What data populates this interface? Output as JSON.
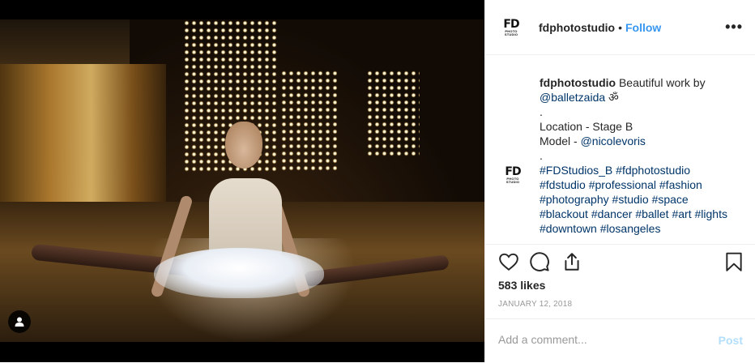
{
  "post": {
    "username": "fdphotostudio",
    "separator": "•",
    "follow_label": "Follow",
    "more_label": "•••",
    "logo_text": "FD",
    "logo_sub": "PHOTO STUDIO"
  },
  "caption": {
    "username": "fdphotostudio",
    "line1_text": " Beautiful work by",
    "mention_artist": "@balletzaida",
    "artist_emoji": "ॐ",
    "dot1": ".",
    "location": "Location - Stage B",
    "model_label": "Model - ",
    "mention_model": "@nicolevoris",
    "dot2": ".",
    "hashtags": [
      "#FDStudios_B",
      "#fdphotostudio",
      "#fdstudio",
      "#professional",
      "#fashion",
      "#photography",
      "#studio",
      "#space",
      "#blackout",
      "#dancer",
      "#ballet",
      "#art",
      "#lights",
      "#downtown",
      "#losangeles"
    ]
  },
  "stats": {
    "likes": "583 likes",
    "date": "JANUARY 12, 2018"
  },
  "comment": {
    "placeholder": "Add a comment...",
    "post_label": "Post"
  },
  "icons": [
    "heart-icon",
    "comment-icon",
    "share-icon",
    "bookmark-icon",
    "user-tag-icon"
  ],
  "colors": {
    "link": "#003569",
    "follow": "#3897f0",
    "post_disabled": "#b2dffc",
    "muted": "#999999",
    "border": "#efefef"
  }
}
